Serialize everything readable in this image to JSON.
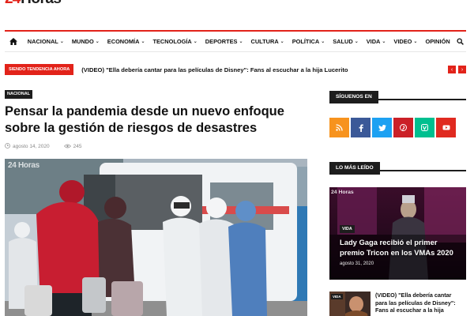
{
  "logo": {
    "number": "24",
    "word": "Horas"
  },
  "nav": {
    "items": [
      {
        "label": "NACIONAL",
        "dropdown": true
      },
      {
        "label": "MUNDO",
        "dropdown": true
      },
      {
        "label": "ECONOMÍA",
        "dropdown": true
      },
      {
        "label": "TECNOLOGÍA",
        "dropdown": true
      },
      {
        "label": "DEPORTES",
        "dropdown": true
      },
      {
        "label": "CULTURA",
        "dropdown": true
      },
      {
        "label": "POLÍTICA",
        "dropdown": true
      },
      {
        "label": "SALUD",
        "dropdown": true
      },
      {
        "label": "VIDA",
        "dropdown": true
      },
      {
        "label": "VIDEO",
        "dropdown": true
      },
      {
        "label": "OPINIÓN",
        "dropdown": false
      }
    ]
  },
  "trending": {
    "badge": "SIENDO TENDENCIA AHORA",
    "headline": "(VIDEO) \"Ella debería cantar para las películas de Disney\": Fans al escuchar a la hija Lucerito"
  },
  "article": {
    "category": "NACIONAL",
    "title": "Pensar la pandemia desde un nuevo enfoque sobre la gestión de riesgos de desastres",
    "date": "agosto 14, 2020",
    "views": "245",
    "image_watermark": "24 Horas"
  },
  "sidebar": {
    "follow_heading": "SÍGUENOS EN",
    "socials": [
      {
        "icon": "rss-icon",
        "color": "#f7931e"
      },
      {
        "icon": "facebook-icon",
        "color": "#3b5998"
      },
      {
        "icon": "twitter-icon",
        "color": "#1da1f2"
      },
      {
        "icon": "pinterest-icon",
        "color": "#cb2027"
      },
      {
        "icon": "vine-icon",
        "color": "#00bf8f"
      },
      {
        "icon": "youtube-icon",
        "color": "#e02a20"
      }
    ],
    "popular_heading": "LO MÁS LEÍDO",
    "featured": {
      "watermark": "24 Horas",
      "category": "VIDA",
      "title": "Lady Gaga recibió el primer premio Tricon en los VMAs 2020",
      "date": "agosto 31, 2020"
    },
    "small": {
      "category": "VIDA",
      "title": "(VIDEO) \"Ella debería cantar para las películas de Disney\": Fans al escuchar a la hija"
    }
  },
  "colors": {
    "accent": "#e2231a",
    "dark": "#1d1d1d"
  }
}
